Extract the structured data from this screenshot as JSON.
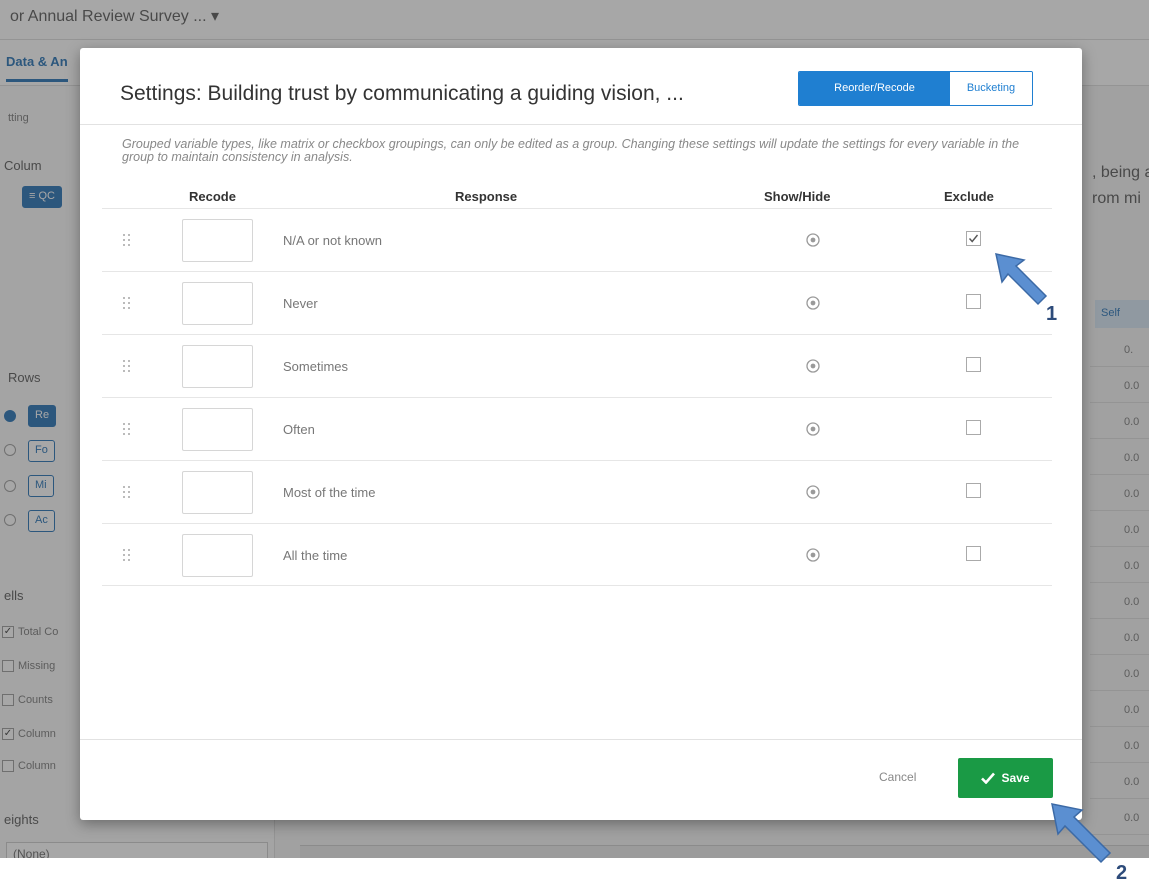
{
  "background": {
    "survey_title": "or Annual Review Survey ... ▾",
    "tab_label": "Data & An",
    "setting_label": "tting",
    "columns_label": "Colum",
    "column_chip": "≡ QC",
    "rows_label": "Rows",
    "row_chips": [
      "Re",
      "Fo",
      "Mi",
      "Ac"
    ],
    "cells_label": "ells",
    "cell_options": [
      {
        "label": "Total Co",
        "checked": true
      },
      {
        "label": "Missing",
        "checked": false
      },
      {
        "label": "Counts",
        "checked": false
      },
      {
        "label": "Column",
        "checked": true
      },
      {
        "label": "Column",
        "checked": false
      }
    ],
    "weights_label": "eights",
    "weights_select": "(None)",
    "right_text_1": ", being a",
    "right_text_2": "rom mi",
    "right_header": "Self",
    "right_cells": [
      "0.",
      "0.0",
      "0.0",
      "0.0",
      "0.0",
      "0.0",
      "0.0",
      "0.0",
      "0.0",
      "0.0",
      "0.0",
      "0.0",
      "0.0",
      "0.0"
    ]
  },
  "modal": {
    "title": "Settings: Building trust by communicating a guiding vision, ...",
    "tabs": [
      {
        "label": "Reorder/Recode",
        "active": true
      },
      {
        "label": "Bucketing",
        "active": false
      }
    ],
    "note": "Grouped variable types, like matrix or checkbox groupings, can only be edited as a group. Changing these settings will update the settings for every variable in the group to maintain consistency in analysis.",
    "columns": {
      "recode": "Recode",
      "response": "Response",
      "show_hide": "Show/Hide",
      "exclude": "Exclude"
    },
    "rows": [
      {
        "response": "N/A or not known",
        "recode": "",
        "visible": true,
        "excluded": true
      },
      {
        "response": "Never",
        "recode": "",
        "visible": true,
        "excluded": false
      },
      {
        "response": "Sometimes",
        "recode": "",
        "visible": true,
        "excluded": false
      },
      {
        "response": "Often",
        "recode": "",
        "visible": true,
        "excluded": false
      },
      {
        "response": "Most of the time",
        "recode": "",
        "visible": true,
        "excluded": false
      },
      {
        "response": "All the time",
        "recode": "",
        "visible": true,
        "excluded": false
      }
    ],
    "cancel_label": "Cancel",
    "save_label": "Save"
  },
  "annotations": [
    {
      "label": "1",
      "color": "#5b8fd1"
    },
    {
      "label": "2",
      "color": "#5b8fd1"
    }
  ],
  "colors": {
    "accent_blue": "#1f7fd1",
    "save_green": "#1a9a45"
  }
}
